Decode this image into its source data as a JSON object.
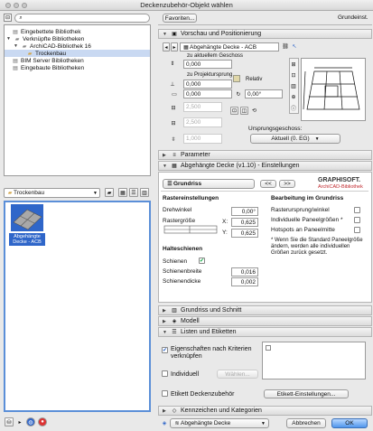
{
  "window": {
    "title": "Deckenzubehör-Objekt wählen"
  },
  "search": {
    "placeholder": ""
  },
  "tree": {
    "items": [
      {
        "label": "Eingebettete Bibliothek",
        "icon": "library-icon"
      },
      {
        "label": "Verknüpfte Bibliotheken",
        "icon": "folder-icon",
        "expanded": true
      },
      {
        "label": "ArchiCAD-Bibliothek 16",
        "icon": "folder-icon",
        "expanded": true
      },
      {
        "label": "Trockenbau",
        "icon": "folder-icon",
        "selected": true
      },
      {
        "label": "BIM Server Bibliotheken",
        "icon": "library-icon"
      },
      {
        "label": "Eingebaute Bibliotheken",
        "icon": "library-icon"
      }
    ]
  },
  "folder": {
    "selected": "Trockenbau"
  },
  "object": {
    "label": "Abgehängte Decke - ACB"
  },
  "top": {
    "favorites": "Favoriten...",
    "default": "Grundeinst."
  },
  "sections": {
    "preview": "Vorschau und Positionierung",
    "params": "Parameter",
    "settings": "Abgehängte Decke (v1.10) - Einstellungen",
    "floorplan": "Grundriss und Schnitt",
    "model": "Modell",
    "listing": "Listen und Etiketten",
    "tags": "Kennzeichen und Kategorien"
  },
  "preview": {
    "object_name": "Abgehängte Decke - ACB",
    "to_story_label": "zu aktuellem Geschoss",
    "to_story_value": "0,000",
    "to_projection_label": "zu Projektursprung",
    "to_projection_value": "0,000",
    "relative_label": "Relativ",
    "height_value": "0,000",
    "angle_value": "0,00°",
    "width_a": "2,500",
    "width_b": "2,500",
    "height_dim": "1,000",
    "origin_label": "Ursprungsgeschoss:",
    "origin_value": "Aktuell (0. EG)"
  },
  "settings": {
    "page_select": "Grundriss",
    "prev": "<<",
    "next": ">>",
    "brand_1": "GRAPHISOFT.",
    "brand_2": "ArchiCAD-Bibliothek",
    "grid_title": "Rastereinstellungen",
    "rotation_label": "Drehwinkel",
    "rotation_value": "0,00°",
    "grid_size_label": "Rastergröße",
    "x_label": "X:",
    "x_value": "0,625",
    "y_label": "Y:",
    "y_value": "0,625",
    "rails_title": "Halteschienen",
    "rails_label": "Schienen",
    "rail_width_label": "Schienenbreite",
    "rail_width_value": "0,016",
    "rail_thick_label": "Schienendicke",
    "rail_thick_value": "0,002",
    "edit_title": "Bearbeitung im Grundriss",
    "edit_1": "Rasterursprung/winkel",
    "edit_2": "Individuelle Paneelgrößen *",
    "edit_3": "Hotspots an Paneelmitte",
    "note": "* Wenn Sie die Standard Paneelgröße ändern, werden alle individuellen Größen zurück gesetzt."
  },
  "listing": {
    "criteria_label": "Eigenschaften nach Kriterien verknüpfen",
    "individual_label": "Individuell",
    "choose_btn": "Wählen...",
    "tag_label": "Etikett Deckenzubehör",
    "tag_btn": "Etikett-Einstellungen..."
  },
  "bottom": {
    "layer": "Abgehängte Decke",
    "cancel": "Abbrechen",
    "ok": "OK"
  },
  "colors": {
    "selection": "#c9d9f2",
    "ok_blue": "#4f95ec",
    "brand_red": "#c0282d"
  }
}
